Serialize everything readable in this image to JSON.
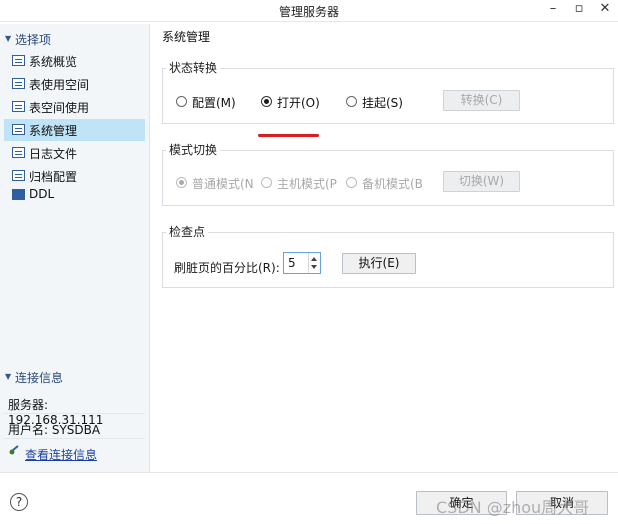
{
  "window": {
    "title": "管理服务器"
  },
  "sidebar": {
    "section_title": "选择项",
    "items": [
      {
        "label": "系统概览"
      },
      {
        "label": "表使用空间"
      },
      {
        "label": "表空间使用"
      },
      {
        "label": "系统管理",
        "active": true
      },
      {
        "label": "日志文件"
      },
      {
        "label": "归档配置"
      },
      {
        "label": "DDL"
      }
    ],
    "connection": {
      "section_title": "连接信息",
      "server": "服务器: 192.168.31.111",
      "user": "用户名: SYSDBA",
      "link": "查看连接信息"
    }
  },
  "main": {
    "title": "系统管理",
    "state_switch": {
      "title": "状态转换",
      "options": [
        {
          "label": "配置(M)",
          "checked": false
        },
        {
          "label": "打开(O)",
          "checked": true
        },
        {
          "label": "挂起(S)",
          "checked": false
        }
      ],
      "button": "转换(C)"
    },
    "mode_switch": {
      "title": "模式切换",
      "options": [
        {
          "label": "普通模式(N",
          "checked": true
        },
        {
          "label": "主机模式(P",
          "checked": false
        },
        {
          "label": "备机模式(B",
          "checked": false
        }
      ],
      "button": "切换(W)"
    },
    "checkpoint": {
      "title": "检查点",
      "label": "刷脏页的百分比(R):",
      "value": "5",
      "button": "执行(E)"
    }
  },
  "footer": {
    "help": "?",
    "ok_button": "确定",
    "cancel_button": "取消",
    "watermark": "CSDN @zhou周大哥"
  },
  "colors": {
    "active_item": "#bfe3f7",
    "link": "#1a3fa0",
    "annotation": "#d81e1e"
  }
}
